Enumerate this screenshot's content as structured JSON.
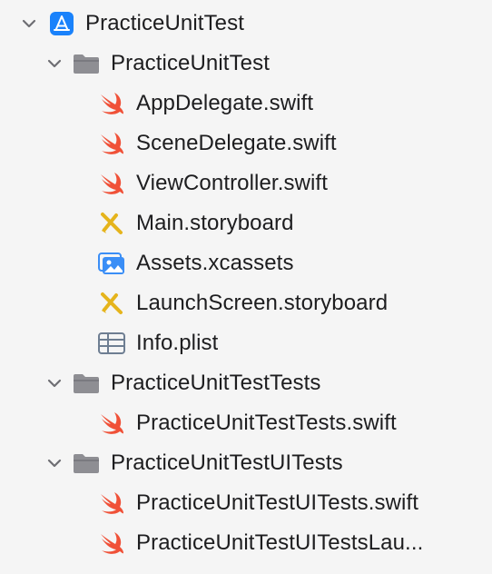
{
  "navigator": {
    "project": {
      "label": "PracticeUnitTest",
      "icon": "xcode-project-icon",
      "expanded": true
    },
    "groups": [
      {
        "label": "PracticeUnitTest",
        "icon": "folder-icon",
        "expanded": true,
        "files": [
          {
            "label": "AppDelegate.swift",
            "icon": "swift-file-icon"
          },
          {
            "label": "SceneDelegate.swift",
            "icon": "swift-file-icon"
          },
          {
            "label": "ViewController.swift",
            "icon": "swift-file-icon"
          },
          {
            "label": "Main.storyboard",
            "icon": "storyboard-file-icon"
          },
          {
            "label": "Assets.xcassets",
            "icon": "asset-catalog-icon"
          },
          {
            "label": "LaunchScreen.storyboard",
            "icon": "storyboard-file-icon"
          },
          {
            "label": "Info.plist",
            "icon": "plist-file-icon"
          }
        ]
      },
      {
        "label": "PracticeUnitTestTests",
        "icon": "folder-icon",
        "expanded": true,
        "files": [
          {
            "label": "PracticeUnitTestTests.swift",
            "icon": "swift-file-icon"
          }
        ]
      },
      {
        "label": "PracticeUnitTestUITests",
        "icon": "folder-icon",
        "expanded": true,
        "files": [
          {
            "label": "PracticeUnitTestUITests.swift",
            "icon": "swift-file-icon"
          },
          {
            "label": "PracticeUnitTestUITestsLau...",
            "icon": "swift-file-icon"
          }
        ]
      }
    ]
  },
  "colors": {
    "swift": "#f05138",
    "project": "#1a82fb",
    "storyboard": "#e5b41c",
    "folder": "#8e8e93",
    "disclosure": "#6e6e73",
    "assets": "#3a8ef6",
    "plist": "#6e7e92"
  }
}
